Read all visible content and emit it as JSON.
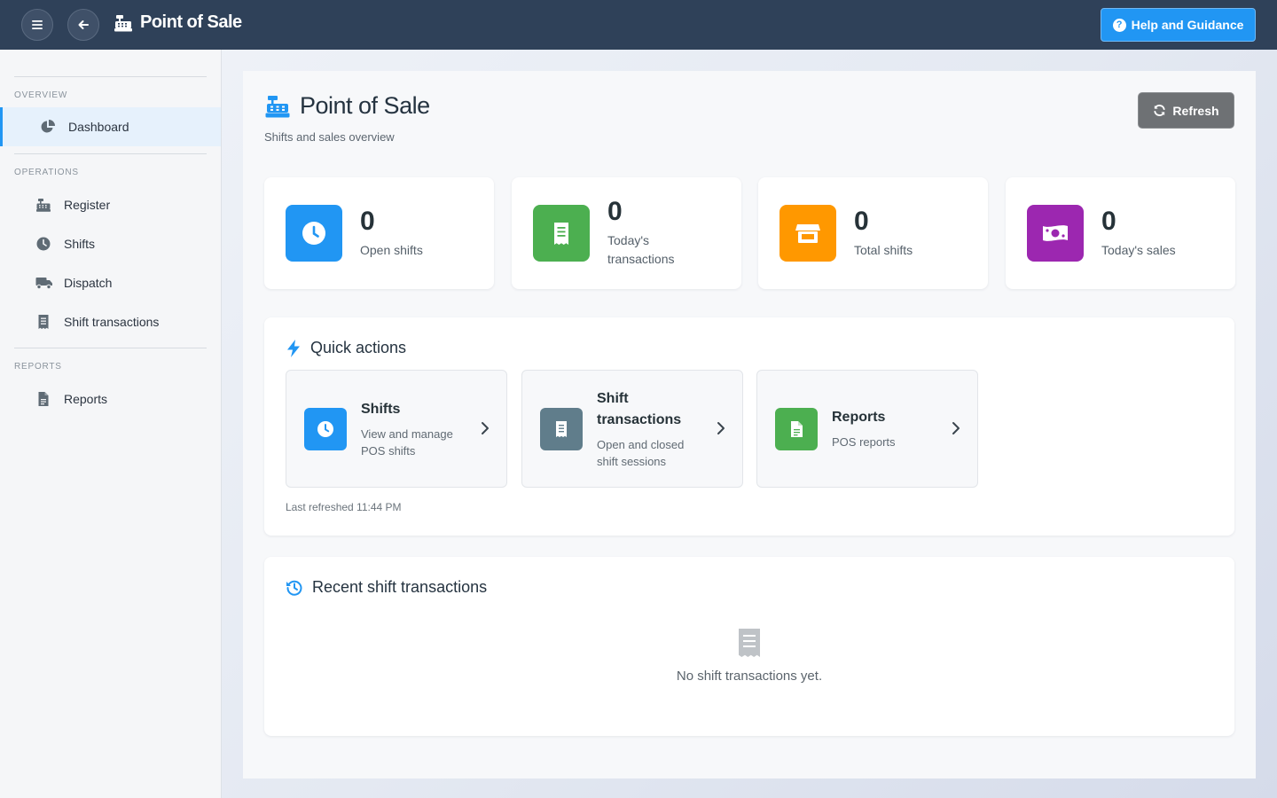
{
  "topbar": {
    "title": "Point of Sale",
    "help_label": "Help and Guidance",
    "help_icon": "?"
  },
  "sidebar": {
    "sections": [
      {
        "label": "OVERVIEW"
      },
      {
        "label": "OPERATIONS"
      },
      {
        "label": "REPORTS"
      }
    ],
    "items": [
      {
        "label": "Dashboard",
        "icon": "chart-pie-icon",
        "active": true
      },
      {
        "label": "Register",
        "icon": "cash-register-icon"
      },
      {
        "label": "Shifts",
        "icon": "clock-icon"
      },
      {
        "label": "Dispatch",
        "icon": "truck-icon"
      },
      {
        "label": "Shift transactions",
        "icon": "receipt-icon"
      },
      {
        "label": "Reports",
        "icon": "file-icon"
      }
    ]
  },
  "page": {
    "title": "Point of Sale",
    "subtitle": "Shifts and sales overview",
    "refresh_label": "Refresh"
  },
  "stats": [
    {
      "value": "0",
      "label": "Open shifts",
      "color": "#2196f3",
      "icon": "clock-icon"
    },
    {
      "value": "0",
      "label": "Today's transactions",
      "color": "#4caf50",
      "icon": "receipt-icon"
    },
    {
      "value": "0",
      "label": "Total shifts",
      "color": "#ff9800",
      "icon": "store-icon"
    },
    {
      "value": "0",
      "label": "Today's sales",
      "color": "#9c27b0",
      "icon": "money-icon"
    }
  ],
  "quick_actions": {
    "title": "Quick actions",
    "tiles": [
      {
        "title": "Shifts",
        "desc": "View and manage POS shifts",
        "color": "#2196f3",
        "icon": "clock-icon"
      },
      {
        "title": "Shift transactions",
        "desc": "Open and closed shift sessions",
        "color": "#607d8b",
        "icon": "receipt-icon"
      },
      {
        "title": "Reports",
        "desc": "POS reports",
        "color": "#4caf50",
        "icon": "file-icon"
      }
    ],
    "last_refreshed": "Last refreshed 11:44 PM"
  },
  "recent": {
    "title": "Recent shift transactions",
    "empty_text": "No shift transactions yet."
  },
  "colors": {
    "accent": "#2196f3",
    "topbar": "#2f4159"
  }
}
